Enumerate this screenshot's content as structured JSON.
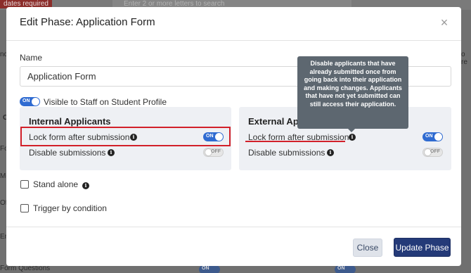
{
  "background": {
    "badge": "dates required",
    "search_placeholder": "Enter 2 or more letters to search",
    "left_fragments": [
      "nce",
      "Ca",
      "Fo",
      "Me",
      "Off",
      "En"
    ],
    "right_fragment": "o re",
    "bottom_label": "Form Questions",
    "bottom_toggles": [
      "ON",
      "ON"
    ]
  },
  "modal": {
    "title": "Edit Phase: Application Form",
    "close_symbol": "×",
    "name_label": "Name",
    "name_value": "Application Form",
    "visible_toggle_state": "ON",
    "visible_label": "Visible to Staff on Student Profile",
    "internal": {
      "title": "Internal Applicants",
      "lock_label": "Lock form after submission",
      "lock_state": "ON",
      "disable_label": "Disable submissions",
      "disable_state": "OFF"
    },
    "external": {
      "title": "External Applic",
      "lock_label": "Lock form after submission",
      "lock_state": "ON",
      "disable_label": "Disable submissions",
      "disable_state": "OFF"
    },
    "tooltip": "Disable applicants that have already submitted once from going back into their application and making changes. Applicants that have not yet submitted can still access their application.",
    "stand_alone_label": "Stand alone",
    "trigger_label": "Trigger by condition",
    "info_glyph": "i",
    "close_button": "Close",
    "update_button": "Update Phase"
  },
  "colors": {
    "accent": "#2f6bd1",
    "primary_button": "#243a78",
    "highlight_red": "#d2202a",
    "tooltip_bg": "#5d6770"
  }
}
